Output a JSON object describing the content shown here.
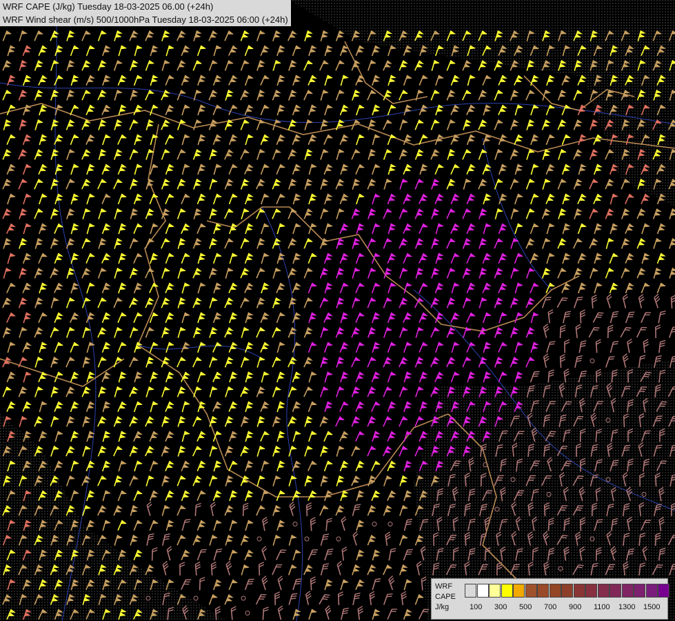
{
  "title": {
    "line1": "WRF CAPE (J/kg) Tuesday 18-03-2025 06.00 (+24h)",
    "line2": "WRF Wind shear (m/s) 500/1000hPa Tuesday 18-03-2025 06:00 (+24h)"
  },
  "legend": {
    "model": "WRF",
    "variable": "CAPE",
    "unit": "J/kg",
    "swatches": [
      "#d9d9d9",
      "#ffffff",
      "#ffff99",
      "#ffff00",
      "#f2a900",
      "#a0522d",
      "#9a4a28",
      "#944525",
      "#8e3f2a",
      "#8a3535",
      "#873040",
      "#842c4c",
      "#822858",
      "#802464",
      "#7e2070",
      "#7a1c7c",
      "#770090"
    ],
    "ticks": [
      "100",
      "300",
      "500",
      "700",
      "900",
      "1100",
      "1300",
      "1500"
    ]
  },
  "colors": {
    "yellow": "#ffff33",
    "tan": "#c8a060",
    "salmon": "#e07060",
    "magenta": "#e020e0",
    "pink": "#b07878",
    "border": "#d8a060",
    "river": "#4060ff",
    "shade": "#555555"
  },
  "symbols": {
    "barb": "wind-barb",
    "calm": "calm-circle"
  }
}
